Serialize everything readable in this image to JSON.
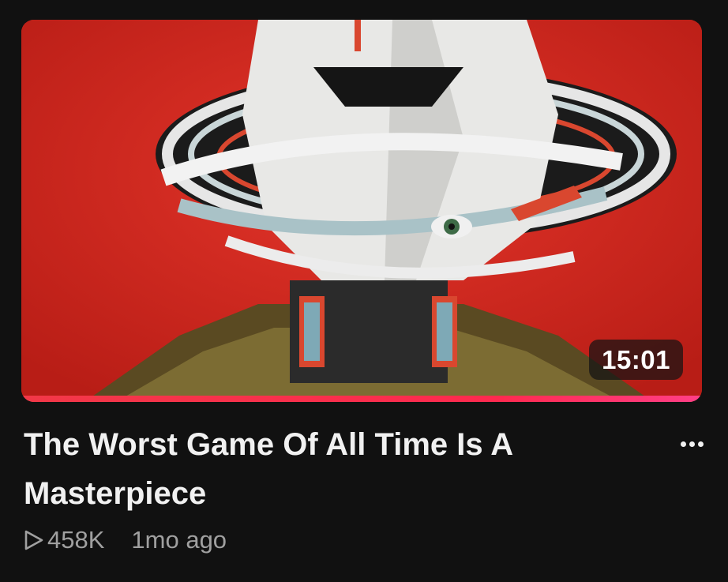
{
  "video": {
    "duration": "15:01",
    "title": "The Worst Game Of All Time Is A Masterpiece",
    "views": "458K",
    "age": "1mo ago",
    "watch_progress": 1.0
  },
  "icons": {
    "views": "play-outline-icon",
    "menu": "more-horizontal-icon"
  },
  "colors": {
    "background": "#111111",
    "thumbnail_bg": "#d8291f",
    "progress": "#f23848",
    "title_text": "#f1f1f1",
    "meta_text": "#a0a0a0"
  }
}
